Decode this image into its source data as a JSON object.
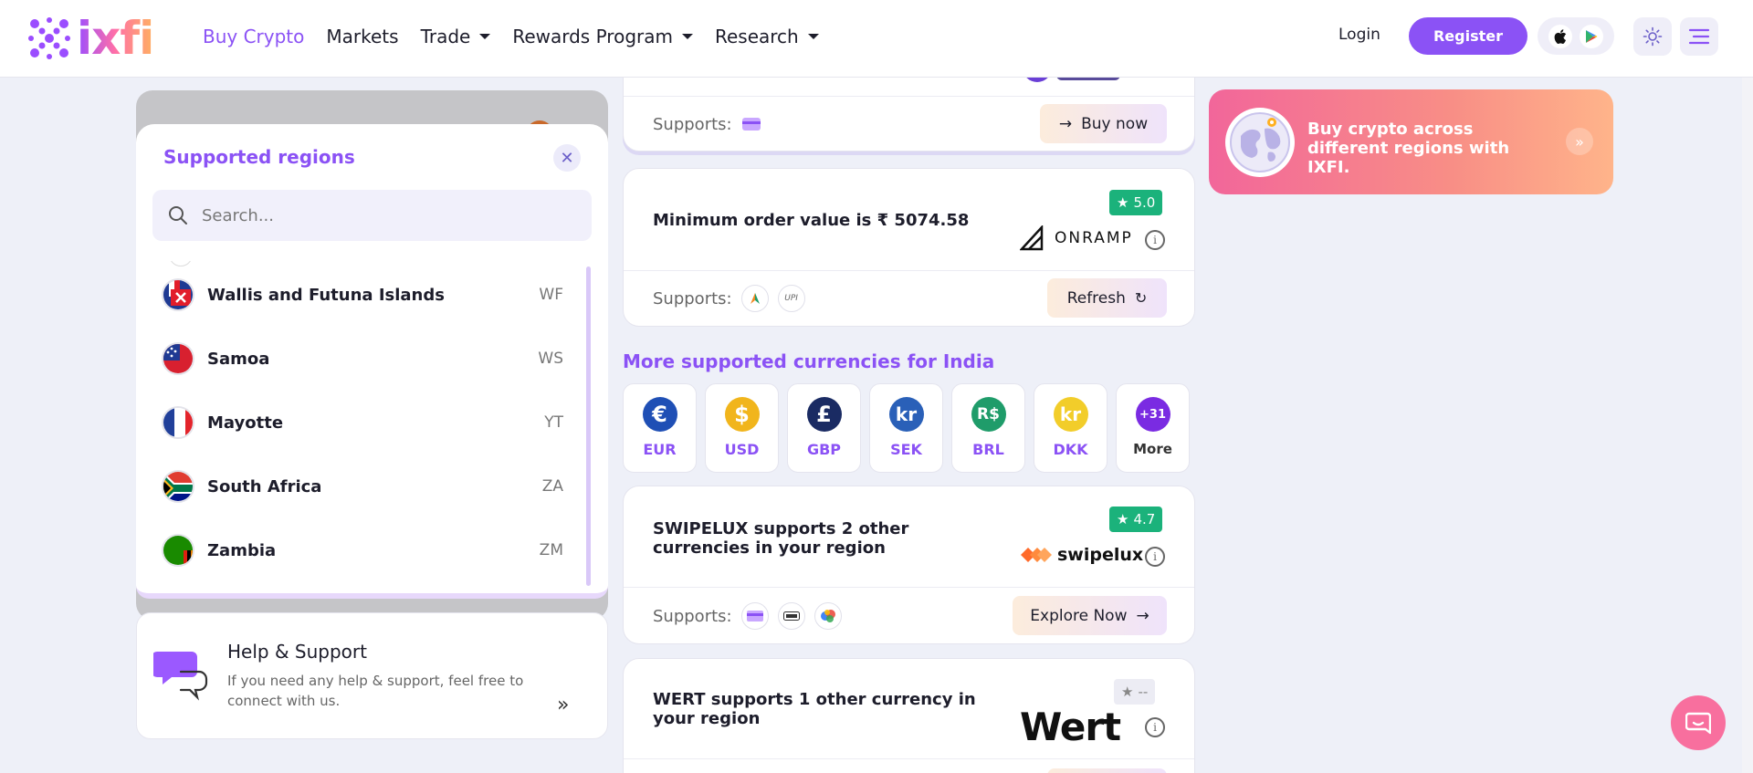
{
  "nav": {
    "logo_text": "ixfi",
    "menu": [
      {
        "label": "Buy Crypto",
        "active": true,
        "dropdown": false
      },
      {
        "label": "Markets",
        "active": false,
        "dropdown": false
      },
      {
        "label": "Trade",
        "active": false,
        "dropdown": true
      },
      {
        "label": "Rewards Program",
        "active": false,
        "dropdown": true
      },
      {
        "label": "Research",
        "active": false,
        "dropdown": true
      }
    ],
    "login": "Login",
    "register": "Register"
  },
  "regions": {
    "title": "Supported regions",
    "search_placeholder": "Search...",
    "countries": [
      {
        "name": "Wallis and Futuna Islands",
        "code": "WF"
      },
      {
        "name": "Samoa",
        "code": "WS"
      },
      {
        "name": "Mayotte",
        "code": "YT"
      },
      {
        "name": "South Africa",
        "code": "ZA"
      },
      {
        "name": "Zambia",
        "code": "ZM"
      }
    ]
  },
  "help": {
    "title": "Help & Support",
    "text": "If you need any help & support, feel free to connect with us."
  },
  "cards": {
    "top": {
      "supports_label": "Supports:",
      "action": "Buy now"
    },
    "onramp": {
      "title_prefix": "Minimum order value is ₹ ",
      "title_value": "5074.58",
      "rating": "5.0",
      "provider": "ONRAMP",
      "supports_label": "Supports:",
      "action": "Refresh",
      "payment_methods": [
        "UPI"
      ]
    },
    "swipelux": {
      "title": "SWIPELUX supports 2 other currencies in your region",
      "rating": "4.7",
      "provider": "swipelux",
      "supports_label": "Supports:",
      "action": "Explore Now"
    },
    "wert": {
      "title": "WERT supports 1 other currency in your region",
      "rating": "--",
      "provider": "Wert"
    }
  },
  "currencies": {
    "title": "More supported currencies for India",
    "items": [
      {
        "code": "EUR",
        "symbol": "€",
        "color": "#1f4fb5"
      },
      {
        "code": "USD",
        "symbol": "$",
        "color": "#f1b51c"
      },
      {
        "code": "GBP",
        "symbol": "£",
        "color": "#1a2b63"
      },
      {
        "code": "SEK",
        "symbol": "kr",
        "color": "#2a60b8"
      },
      {
        "code": "BRL",
        "symbol": "R$",
        "color": "#1f9c6a"
      },
      {
        "code": "DKK",
        "symbol": "kr",
        "color": "#f2cd2a"
      }
    ],
    "more_count": "+31",
    "more_label": "More"
  },
  "promo": {
    "text": "Buy crypto across different regions with IXFI."
  },
  "colors": {
    "accent": "#8b52f5",
    "rating_green": "#1bb27b",
    "promo_pink": "#f2669a",
    "promo_peach": "#ffb48a"
  }
}
